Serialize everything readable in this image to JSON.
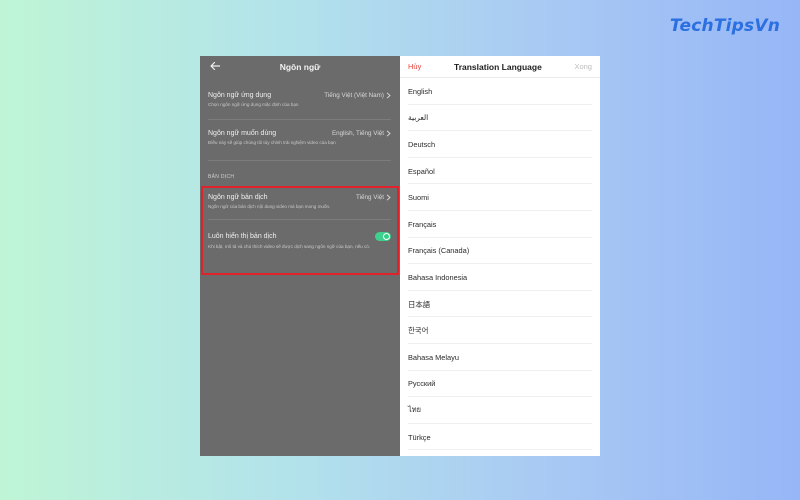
{
  "brand": {
    "name": "TechTipsVn",
    "color": "#2b6fe0"
  },
  "left_panel": {
    "title": "Ngôn ngữ",
    "settings": [
      {
        "label": "Ngôn ngữ ứng dụng",
        "value": "Tiếng Việt (Việt Nam)",
        "desc": "Chọn ngôn ngữ ứng dụng mặc định của bạn"
      },
      {
        "label": "Ngôn ngữ muốn dùng",
        "value": "English, Tiếng Việt",
        "desc": "Điều này sẽ giúp chúng tôi tùy chỉnh trải nghiệm video của bạn"
      }
    ],
    "section_label": "BẢN DỊCH",
    "translation": {
      "label": "Ngôn ngữ bản dịch",
      "value": "Tiếng Việt",
      "desc": "Ngôn ngữ của bản dịch nội dung video mà bạn mong muốn."
    },
    "always_show": {
      "label": "Luôn hiển thị bản dịch",
      "desc": "Khi bật, mô tả và chú thích video sẽ được dịch sang ngôn ngữ của bạn, nếu có.",
      "enabled": true
    },
    "highlight_color": "#e0232b"
  },
  "right_panel": {
    "cancel_label": "Hủy",
    "title": "Translation Language",
    "done_label": "Xong",
    "languages": [
      "English",
      "العربية",
      "Deutsch",
      "Español",
      "Suomi",
      "Français",
      "Français (Canada)",
      "Bahasa Indonesia",
      "日本語",
      "한국어",
      "Bahasa Melayu",
      "Русский",
      "ไทย",
      "Türkçe"
    ],
    "accent_color": "#e8453c"
  }
}
